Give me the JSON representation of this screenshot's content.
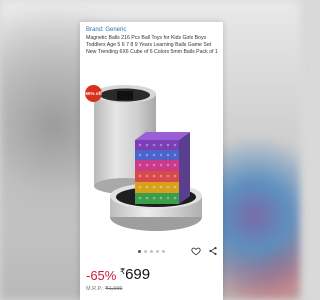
{
  "product": {
    "brand": "Brand: Generic",
    "title": "Magnetic Balls 216 Pcs Ball Toys for Kids Girls Boys Toddlers Age 5 6 7 8 9 Years Learning Balls Game Set New Trending 6X6 Cube of 6 Colors 5mm Balls Pack of 1",
    "badge": "65% off",
    "discount": "-65%",
    "price_symbol": "₹",
    "price": "699",
    "mrp_label": "M.R.P.:",
    "mrp_value": "₹1,999"
  },
  "gallery": {
    "image_count": 5,
    "active_index": 0
  },
  "colors": {
    "discount": "#cc1c39",
    "badge": "#d8321d",
    "brand_link": "#2b6fb4"
  }
}
